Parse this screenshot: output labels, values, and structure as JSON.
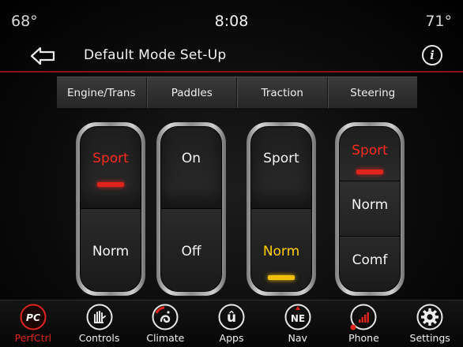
{
  "status": {
    "temp_left": "68°",
    "clock": "8:08",
    "temp_right": "71°"
  },
  "header": {
    "title": "Default Mode Set-Up",
    "back_icon": "back-arrow-icon",
    "info_icon": "info-icon",
    "info_glyph": "i"
  },
  "tabs": [
    "Engine/Trans",
    "Paddles",
    "Traction",
    "Steering"
  ],
  "selectors": {
    "engine": {
      "top": "Sport",
      "bottom": "Norm",
      "selected": "Sport"
    },
    "paddles": {
      "top": "On",
      "bottom": "Off",
      "selected": "none"
    },
    "traction": {
      "top": "Sport",
      "bottom": "Norm",
      "selected": "Norm"
    },
    "steering": {
      "top": "Sport",
      "middle": "Norm",
      "bottom": "Comf",
      "selected": "Sport"
    }
  },
  "nav": {
    "perfctrl": {
      "label": "PerfCtrl",
      "icon": "perfctrl-icon",
      "glyph": "PC",
      "active": true
    },
    "controls": {
      "label": "Controls",
      "icon": "hand-controls-icon"
    },
    "climate": {
      "label": "Climate",
      "icon": "climate-icon"
    },
    "apps": {
      "label": "Apps",
      "icon": "apps-icon",
      "glyph": "û"
    },
    "nav": {
      "label": "Nav",
      "icon": "compass-nav-icon",
      "glyph": "NE"
    },
    "phone": {
      "label": "Phone",
      "icon": "phone-signal-icon"
    },
    "settings": {
      "label": "Settings",
      "icon": "gear-icon"
    }
  },
  "colors": {
    "accent_red": "#e0241d",
    "selected_yellow": "#f2c200",
    "header_line": "#8a1412"
  }
}
